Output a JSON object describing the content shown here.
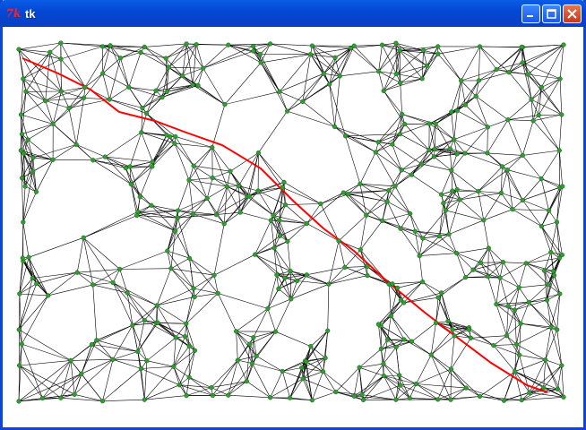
{
  "window": {
    "title": "tk",
    "app_icon": "tk-feather-icon"
  },
  "controls": {
    "minimize": "minimize-icon",
    "maximize": "maximize-icon",
    "close": "close-icon"
  },
  "graph": {
    "edge_color": "#000000",
    "node_color": "#2e9e2e",
    "path_color": "#ff0000"
  }
}
